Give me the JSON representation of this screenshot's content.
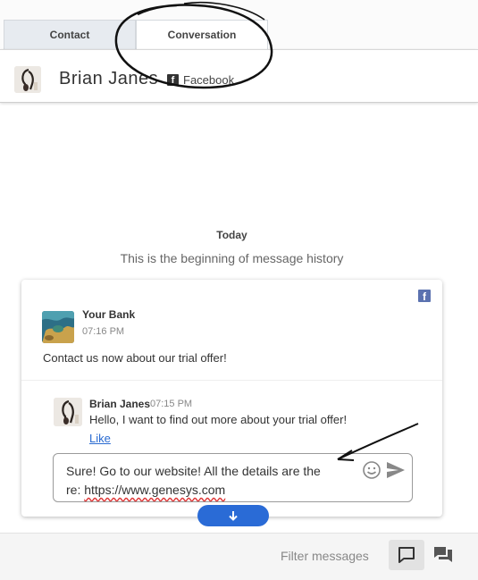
{
  "tabs": {
    "contact": "Contact",
    "conversation": "Conversation"
  },
  "header": {
    "name": "Brian Janes",
    "channel": "Facebook"
  },
  "history": {
    "today": "Today",
    "beginning": "This is the beginning of message history"
  },
  "card": {
    "sender": {
      "name": "Your Bank",
      "time": "07:16 PM",
      "message": "Contact us now about our trial offer!"
    },
    "reply_msg": {
      "name": "Brian Janes",
      "time": "07:15 PM",
      "message": "Hello, I want to find out more about your trial offer!",
      "like": "Like"
    },
    "composer": {
      "line1": "Sure! Go to our website! All the details are the",
      "line2_prefix": "re: ",
      "url": "https://www.genesys.com"
    }
  },
  "footer": {
    "filter_label": "Filter messages"
  },
  "colors": {
    "accent": "#2a6bd6",
    "facebook": "#5b72b0"
  },
  "icons": [
    "facebook-icon",
    "smiley-icon",
    "send-icon",
    "arrow-down-icon",
    "chat-icon",
    "chat-stack-icon"
  ]
}
